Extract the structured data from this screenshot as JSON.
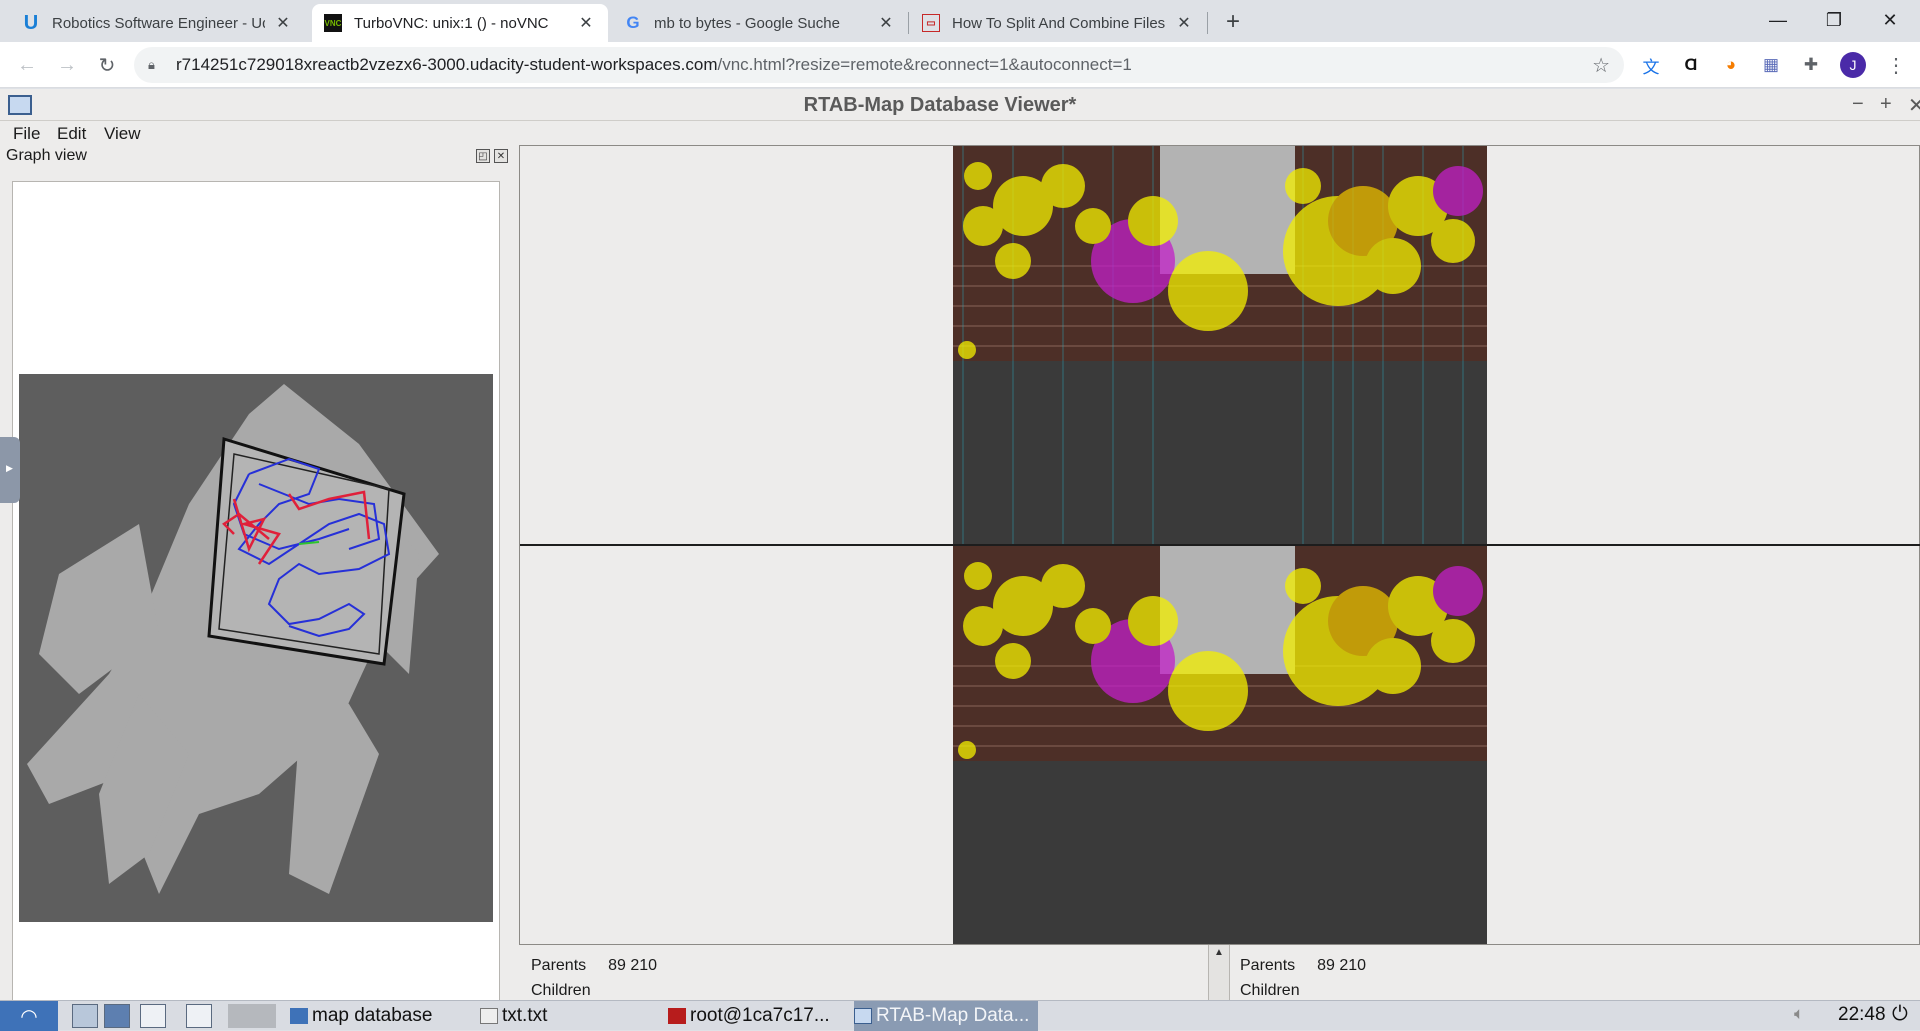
{
  "browser": {
    "tabs": [
      {
        "title": "Robotics Software Engineer - Uda",
        "icon": "udacity-icon",
        "active": false
      },
      {
        "title": "TurboVNC: unix:1 () - noVNC",
        "icon": "vnc-icon",
        "active": true
      },
      {
        "title": "mb to bytes - Google Suche",
        "icon": "google-icon",
        "active": false
      },
      {
        "title": "How To Split And Combine Files F",
        "icon": "website-icon",
        "active": false
      }
    ],
    "url_host": "r714251c729018xreactb2vzezx6-3000.udacity-student-workspaces.com",
    "url_path": "/vnc.html?resize=remote&reconnect=1&autoconnect=1",
    "avatar_letter": "J"
  },
  "app": {
    "title": "RTAB-Map Database Viewer*",
    "menu": [
      "File",
      "Edit",
      "View"
    ],
    "dock_title": "Graph view",
    "info_left": {
      "parents_label": "Parents",
      "parents_value": "89 210",
      "children_label": "Children"
    },
    "info_right": {
      "parents_label": "Parents",
      "parents_value": "89 210",
      "children_label": "Children"
    }
  },
  "taskbar": {
    "tasks": [
      {
        "label": "map database",
        "active": false
      },
      {
        "label": "txt.txt",
        "active": false
      },
      {
        "label": "root@1ca7c17...",
        "active": false
      },
      {
        "label": "RTAB-Map Data...",
        "active": true
      }
    ],
    "clock": "22:48"
  },
  "colors": {
    "accent_vnc": "#76b900",
    "feature_yellow": "#f4f000",
    "feature_magenta": "#c21fc8",
    "graph_blue": "#2630d8",
    "graph_red": "#e0203a",
    "start_button": "#3e72b8"
  }
}
